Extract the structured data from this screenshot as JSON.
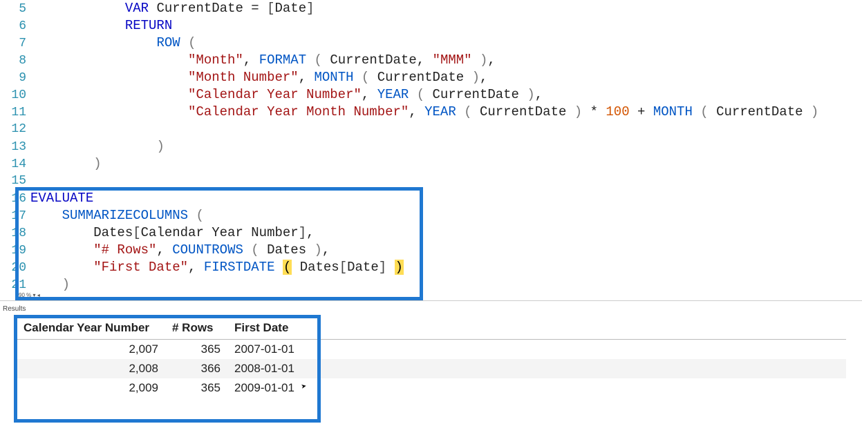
{
  "editor": {
    "lines": [
      {
        "n": "5",
        "indent": "            ",
        "tokens": [
          {
            "t": "VAR",
            "c": "kw"
          },
          {
            "t": " CurrentDate ",
            "c": "txt"
          },
          {
            "t": "=",
            "c": "txt"
          },
          {
            "t": " ",
            "c": "txt"
          },
          {
            "t": "[",
            "c": "brack"
          },
          {
            "t": "Date",
            "c": "txt"
          },
          {
            "t": "]",
            "c": "brack"
          }
        ]
      },
      {
        "n": "6",
        "indent": "            ",
        "tokens": [
          {
            "t": "RETURN",
            "c": "kw"
          }
        ]
      },
      {
        "n": "7",
        "indent": "                ",
        "tokens": [
          {
            "t": "ROW",
            "c": "fn"
          },
          {
            "t": " ",
            "c": "txt"
          },
          {
            "t": "(",
            "c": "paren"
          }
        ]
      },
      {
        "n": "8",
        "indent": "                    ",
        "tokens": [
          {
            "t": "\"Month\"",
            "c": "str"
          },
          {
            "t": ", ",
            "c": "txt"
          },
          {
            "t": "FORMAT",
            "c": "fn"
          },
          {
            "t": " ",
            "c": "txt"
          },
          {
            "t": "(",
            "c": "paren"
          },
          {
            "t": " CurrentDate, ",
            "c": "txt"
          },
          {
            "t": "\"MMM\"",
            "c": "str"
          },
          {
            "t": " ",
            "c": "txt"
          },
          {
            "t": ")",
            "c": "paren"
          },
          {
            "t": ",",
            "c": "txt"
          }
        ]
      },
      {
        "n": "9",
        "indent": "                    ",
        "tokens": [
          {
            "t": "\"Month Number\"",
            "c": "str"
          },
          {
            "t": ", ",
            "c": "txt"
          },
          {
            "t": "MONTH",
            "c": "fn"
          },
          {
            "t": " ",
            "c": "txt"
          },
          {
            "t": "(",
            "c": "paren"
          },
          {
            "t": " CurrentDate ",
            "c": "txt"
          },
          {
            "t": ")",
            "c": "paren"
          },
          {
            "t": ",",
            "c": "txt"
          }
        ]
      },
      {
        "n": "10",
        "indent": "                    ",
        "tokens": [
          {
            "t": "\"Calendar Year Number\"",
            "c": "str"
          },
          {
            "t": ", ",
            "c": "txt"
          },
          {
            "t": "YEAR",
            "c": "fn"
          },
          {
            "t": " ",
            "c": "txt"
          },
          {
            "t": "(",
            "c": "paren"
          },
          {
            "t": " CurrentDate ",
            "c": "txt"
          },
          {
            "t": ")",
            "c": "paren"
          },
          {
            "t": ",",
            "c": "txt"
          }
        ]
      },
      {
        "n": "11",
        "indent": "                    ",
        "tokens": [
          {
            "t": "\"Calendar Year Month Number\"",
            "c": "str"
          },
          {
            "t": ", ",
            "c": "txt"
          },
          {
            "t": "YEAR",
            "c": "fn"
          },
          {
            "t": " ",
            "c": "txt"
          },
          {
            "t": "(",
            "c": "paren"
          },
          {
            "t": " CurrentDate ",
            "c": "txt"
          },
          {
            "t": ")",
            "c": "paren"
          },
          {
            "t": " * ",
            "c": "txt"
          },
          {
            "t": "100",
            "c": "num"
          },
          {
            "t": " + ",
            "c": "txt"
          },
          {
            "t": "MONTH",
            "c": "fn"
          },
          {
            "t": " ",
            "c": "txt"
          },
          {
            "t": "(",
            "c": "paren"
          },
          {
            "t": " CurrentDate ",
            "c": "txt"
          },
          {
            "t": ")",
            "c": "paren"
          }
        ]
      },
      {
        "n": "12",
        "indent": "",
        "tokens": []
      },
      {
        "n": "13",
        "indent": "                ",
        "tokens": [
          {
            "t": ")",
            "c": "paren"
          }
        ]
      },
      {
        "n": "14",
        "indent": "        ",
        "tokens": [
          {
            "t": ")",
            "c": "paren"
          }
        ]
      },
      {
        "n": "15",
        "indent": "",
        "tokens": []
      },
      {
        "n": "16",
        "indent": "",
        "tokens": [
          {
            "t": "EVALUATE",
            "c": "kw"
          }
        ]
      },
      {
        "n": "17",
        "indent": "    ",
        "tokens": [
          {
            "t": "SUMMARIZECOLUMNS",
            "c": "fn"
          },
          {
            "t": " ",
            "c": "txt"
          },
          {
            "t": "(",
            "c": "paren"
          }
        ]
      },
      {
        "n": "18",
        "indent": "        ",
        "tokens": [
          {
            "t": "Dates",
            "c": "txt"
          },
          {
            "t": "[",
            "c": "brack"
          },
          {
            "t": "Calendar Year Number",
            "c": "txt"
          },
          {
            "t": "]",
            "c": "brack"
          },
          {
            "t": ",",
            "c": "txt"
          }
        ]
      },
      {
        "n": "19",
        "indent": "        ",
        "tokens": [
          {
            "t": "\"# Rows\"",
            "c": "str"
          },
          {
            "t": ", ",
            "c": "txt"
          },
          {
            "t": "COUNTROWS",
            "c": "fn"
          },
          {
            "t": " ",
            "c": "txt"
          },
          {
            "t": "(",
            "c": "paren"
          },
          {
            "t": " Dates ",
            "c": "txt"
          },
          {
            "t": ")",
            "c": "paren"
          },
          {
            "t": ",",
            "c": "txt"
          }
        ]
      },
      {
        "n": "20",
        "indent": "        ",
        "tokens": [
          {
            "t": "\"First Date\"",
            "c": "str"
          },
          {
            "t": ", ",
            "c": "txt"
          },
          {
            "t": "FIRSTDATE",
            "c": "fn"
          },
          {
            "t": " ",
            "c": "txt"
          },
          {
            "t": "(",
            "c": "brkhl"
          },
          {
            "t": " Dates",
            "c": "txt"
          },
          {
            "t": "[",
            "c": "brack"
          },
          {
            "t": "Date",
            "c": "txt"
          },
          {
            "t": "]",
            "c": "brack"
          },
          {
            "t": " ",
            "c": "txt"
          },
          {
            "t": ")",
            "c": "brkhl"
          }
        ]
      },
      {
        "n": "21",
        "indent": "    ",
        "tokens": [
          {
            "t": ")",
            "c": "paren"
          }
        ]
      }
    ]
  },
  "zoom": "90 % ▾ ◂",
  "results_label": "Results",
  "results": {
    "headers": [
      "Calendar Year Number",
      "# Rows",
      "First Date"
    ],
    "rows": [
      {
        "year": "2,007",
        "rows": "365",
        "date": "2007-01-01",
        "alt": false
      },
      {
        "year": "2,008",
        "rows": "366",
        "date": "2008-01-01",
        "alt": true
      },
      {
        "year": "2,009",
        "rows": "365",
        "date": "2009-01-01",
        "alt": false
      }
    ]
  }
}
